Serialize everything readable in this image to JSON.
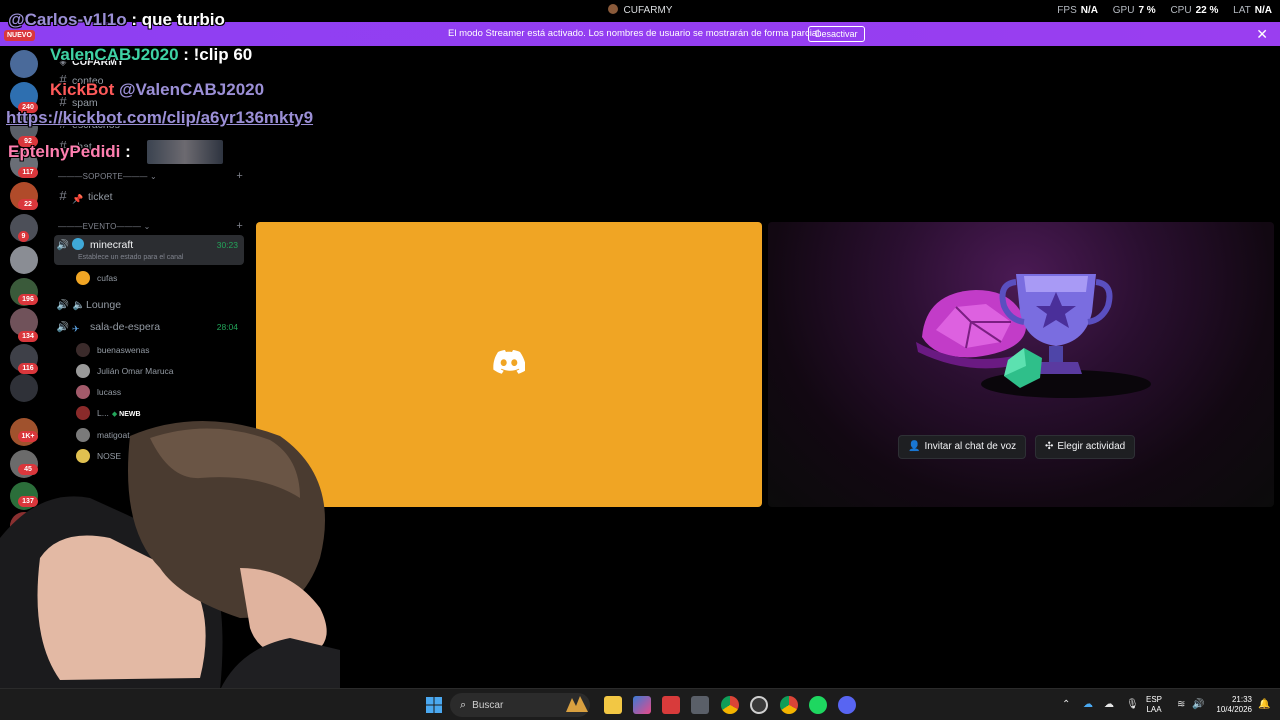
{
  "window": {
    "title": "CUFARMY",
    "perf": {
      "fps_label": "FPS",
      "fps": "N/A",
      "gpu_label": "GPU",
      "gpu": "7 %",
      "cpu_label": "CPU",
      "cpu": "22 %",
      "lat_label": "LAT",
      "lat": "N/A"
    }
  },
  "banner": {
    "text": "El modo Streamer está activado. Los nombres de usuario se mostrarán de forma parcial.",
    "button": "Desactivar",
    "close": "✕"
  },
  "rail": {
    "new_label": "NUEVO",
    "badges": [
      "240",
      "92",
      "117",
      "22",
      "9",
      "196",
      "134",
      "116",
      "1K+",
      "45",
      "137"
    ]
  },
  "channels": {
    "server_name": "CUFARMY",
    "text_channels": [
      {
        "name": "conteo"
      },
      {
        "name": "spam"
      },
      {
        "name": "escrachos"
      },
      {
        "name": "chat"
      }
    ],
    "categories": {
      "soporte": "———SOPORTE———",
      "evento": "———EVENTO———"
    },
    "ticket": "ticket",
    "minecraft": {
      "name": "minecraft",
      "timer": "30:23",
      "status": "Establece un estado para el canal"
    },
    "minecraft_users": [
      "cufas"
    ],
    "lounge": "Lounge",
    "sala": {
      "name": "sala-de-espera",
      "timer": "28:04"
    },
    "sala_users": [
      "buenaswenas",
      "Julián Omar Maruca",
      "lucass",
      "L...",
      "matigoat",
      "NOSE"
    ],
    "newb_tag": "NEWB"
  },
  "stage": {
    "invite_button": "Invitar al chat de voz",
    "activity_button": "Elegir actividad"
  },
  "chat_overlay": [
    {
      "user": "@Carlos-v1l1o",
      "message": ": que turbio"
    },
    {
      "user": "ValenCABJ2020",
      "message": ": !clip 60"
    },
    {
      "user": "KickBot",
      "mention": "@ValenCABJ2020"
    },
    {
      "link": "https://kickbot.com/clip/a6yr136mkty9"
    },
    {
      "user": "EptelnyPedidi",
      "message": ":"
    }
  ],
  "taskbar": {
    "search_label": "Buscar",
    "lang_top": "ESP",
    "lang_bottom": "LAA",
    "time": "21:33",
    "date": "10/4/2026"
  }
}
